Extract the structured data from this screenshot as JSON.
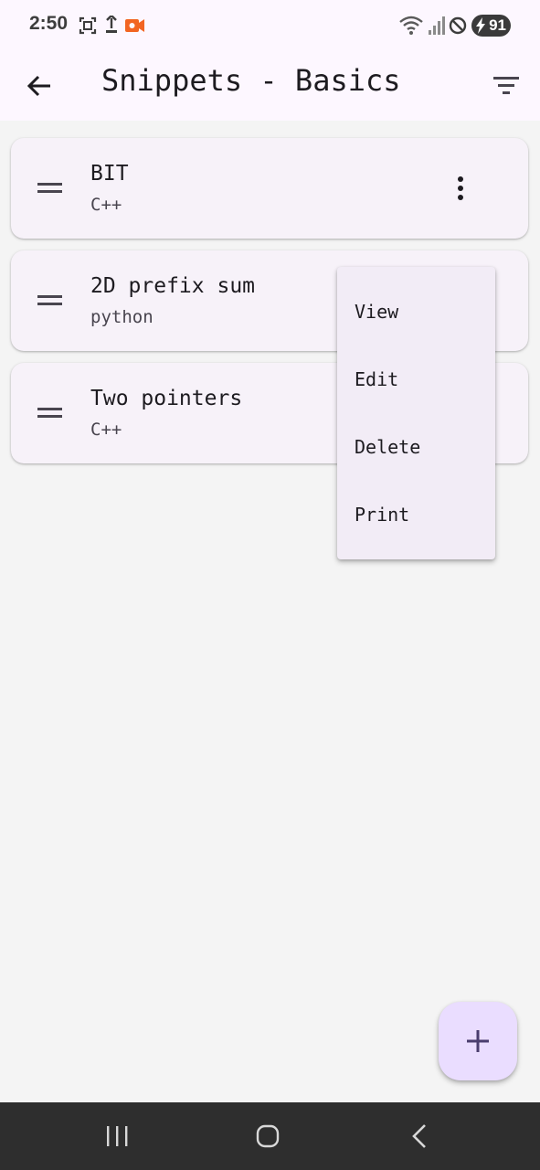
{
  "status_bar": {
    "time": "2:50",
    "battery": "91",
    "left_icons": [
      "screenshot-icon",
      "download-icon",
      "screen-record-icon"
    ],
    "right_icons": [
      "wifi-icon",
      "signal-icon",
      "do-not-disturb-icon",
      "battery-icon"
    ]
  },
  "app_bar": {
    "title": "Snippets - Basics",
    "back_icon": "arrow-back-icon",
    "filter_icon": "filter-icon"
  },
  "snippets": [
    {
      "title": "BIT",
      "language": "C++"
    },
    {
      "title": "2D prefix sum",
      "language": "python"
    },
    {
      "title": "Two pointers",
      "language": "C++"
    }
  ],
  "menu": {
    "items": [
      "View",
      "Edit",
      "Delete",
      "Print"
    ]
  },
  "fab": {
    "icon": "plus-icon"
  },
  "nav_bar": {
    "icons": [
      "recent-apps-icon",
      "home-icon",
      "back-icon"
    ]
  },
  "colors": {
    "app_bar_bg": "#fdf7ff",
    "page_bg": "#f4f4f4",
    "card_bg": "#f7f2f9",
    "menu_bg": "#f2ecf6",
    "fab_bg": "#eaddff",
    "fab_icon": "#4a3d6e",
    "nav_bar_bg": "#2e2e2e",
    "record_indicator": "#f26522"
  }
}
